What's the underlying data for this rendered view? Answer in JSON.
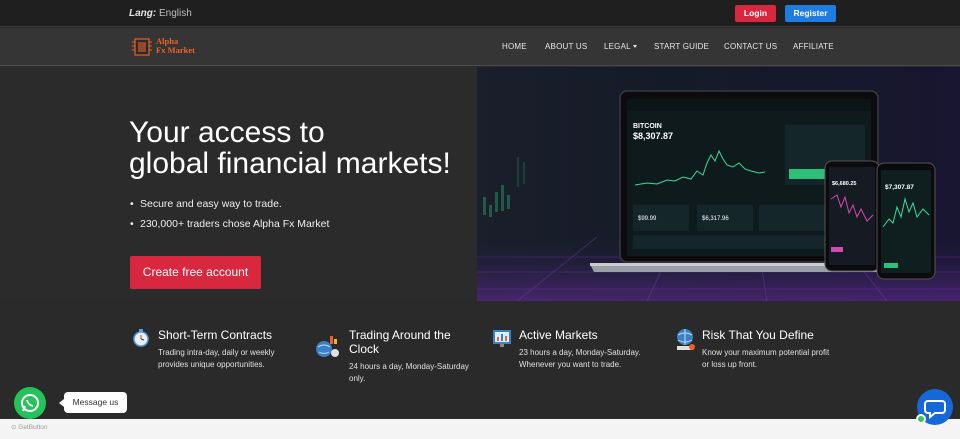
{
  "topbar": {
    "lang_label": "Lang:",
    "lang_value": "English",
    "login": "Login",
    "register": "Register"
  },
  "logo": {
    "line1": "Alpha",
    "line2": "Fx Market"
  },
  "nav": {
    "items": [
      "HOME",
      "ABOUT US",
      "LEGAL",
      "START GUIDE",
      "CONTACT US",
      "AFFILIATE"
    ]
  },
  "hero": {
    "title_line1": "Your access to",
    "title_line2": "global financial markets!",
    "bullets": [
      "Secure and easy way to trade.",
      "230,000+ traders chose Alpha Fx Market"
    ],
    "cta": "Create free account",
    "laptop": {
      "asset": "BITCOIN",
      "price": "$8,307.87",
      "tile1": "$99.99",
      "tile2": "$6,317.96"
    },
    "phone_small_price": "$6,680.25",
    "phone_big_price": "$7,307.87"
  },
  "features": [
    {
      "title": "Short-Term Contracts",
      "desc_line1": "Trading intra-day, daily or weekly",
      "desc_line2": "provides unique opportunities."
    },
    {
      "title_line1": "Trading Around the",
      "title_line2": "Clock",
      "desc_line1": "24 hours a day, Monday-Saturday",
      "desc_line2": "only."
    },
    {
      "title": "Active Markets",
      "desc_line1": "23 hours a day, Monday-Saturday.",
      "desc_line2": "Whenever you want to trade."
    },
    {
      "title": "Risk That You Define",
      "desc_line1": "Know your maximum potential profit",
      "desc_line2": "or loss up front."
    }
  ],
  "widgets": {
    "message": "Message us",
    "getbutton": "GetButton"
  },
  "colors": {
    "accent_red": "#d8283f",
    "accent_blue": "#1f7de2",
    "chart_green": "#3ddc97",
    "logo_orange": "#e8632a"
  }
}
